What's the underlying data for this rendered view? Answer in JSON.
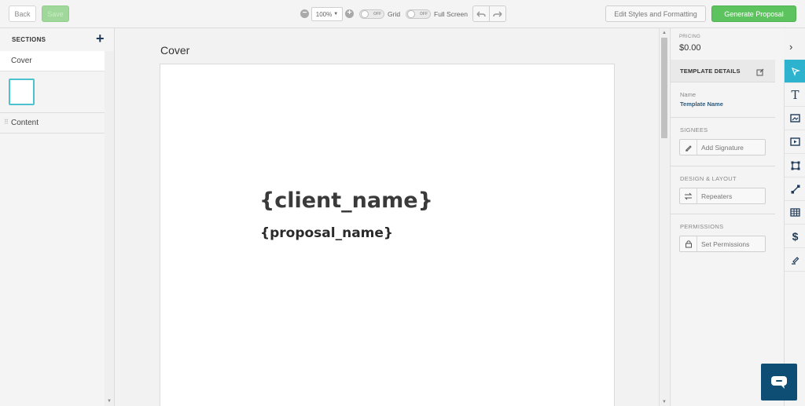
{
  "toolbar": {
    "back_label": "Back",
    "save_label": "Save",
    "zoom_value": "100%",
    "grid_toggle": {
      "label": "Grid",
      "state": "OFF"
    },
    "fullscreen_toggle": {
      "label": "Full Screen",
      "state": "OFF"
    },
    "edit_styles_label": "Edit Styles and Formatting",
    "generate_label": "Generate Proposal"
  },
  "sidebar": {
    "title": "SECTIONS",
    "add_icon": "plus-icon",
    "sections": [
      {
        "label": "Cover",
        "selected": true
      },
      {
        "label": "Content",
        "selected": false
      }
    ]
  },
  "canvas": {
    "page_label": "Cover",
    "client_name": "{client_name}",
    "proposal_name": "{proposal_name}"
  },
  "right_panel": {
    "pricing_label": "PRICING",
    "pricing_value": "$0.00",
    "template_details_title": "TEMPLATE DETAILS",
    "name_label": "Name",
    "name_value": "Template Name",
    "signees_label": "SIGNEES",
    "add_signature_label": "Add Signature",
    "design_layout_label": "DESIGN & LAYOUT",
    "repeaters_label": "Repeaters",
    "permissions_label": "PERMISSIONS",
    "set_permissions_label": "Set Permissions"
  },
  "tool_rail": [
    {
      "icon": "pointer-icon",
      "active": true
    },
    {
      "icon": "text-icon",
      "active": false
    },
    {
      "icon": "image-icon",
      "active": false
    },
    {
      "icon": "video-icon",
      "active": false
    },
    {
      "icon": "shape-icon",
      "active": false
    },
    {
      "icon": "line-icon",
      "active": false
    },
    {
      "icon": "table-icon",
      "active": false
    },
    {
      "icon": "dollar-icon",
      "active": false
    },
    {
      "icon": "signature-icon",
      "active": false
    }
  ],
  "colors": {
    "accent": "#2db3ce",
    "generate_green": "#5cc35e",
    "chat_blue": "#0e4e74",
    "brand_navy": "#1e3a5a"
  }
}
